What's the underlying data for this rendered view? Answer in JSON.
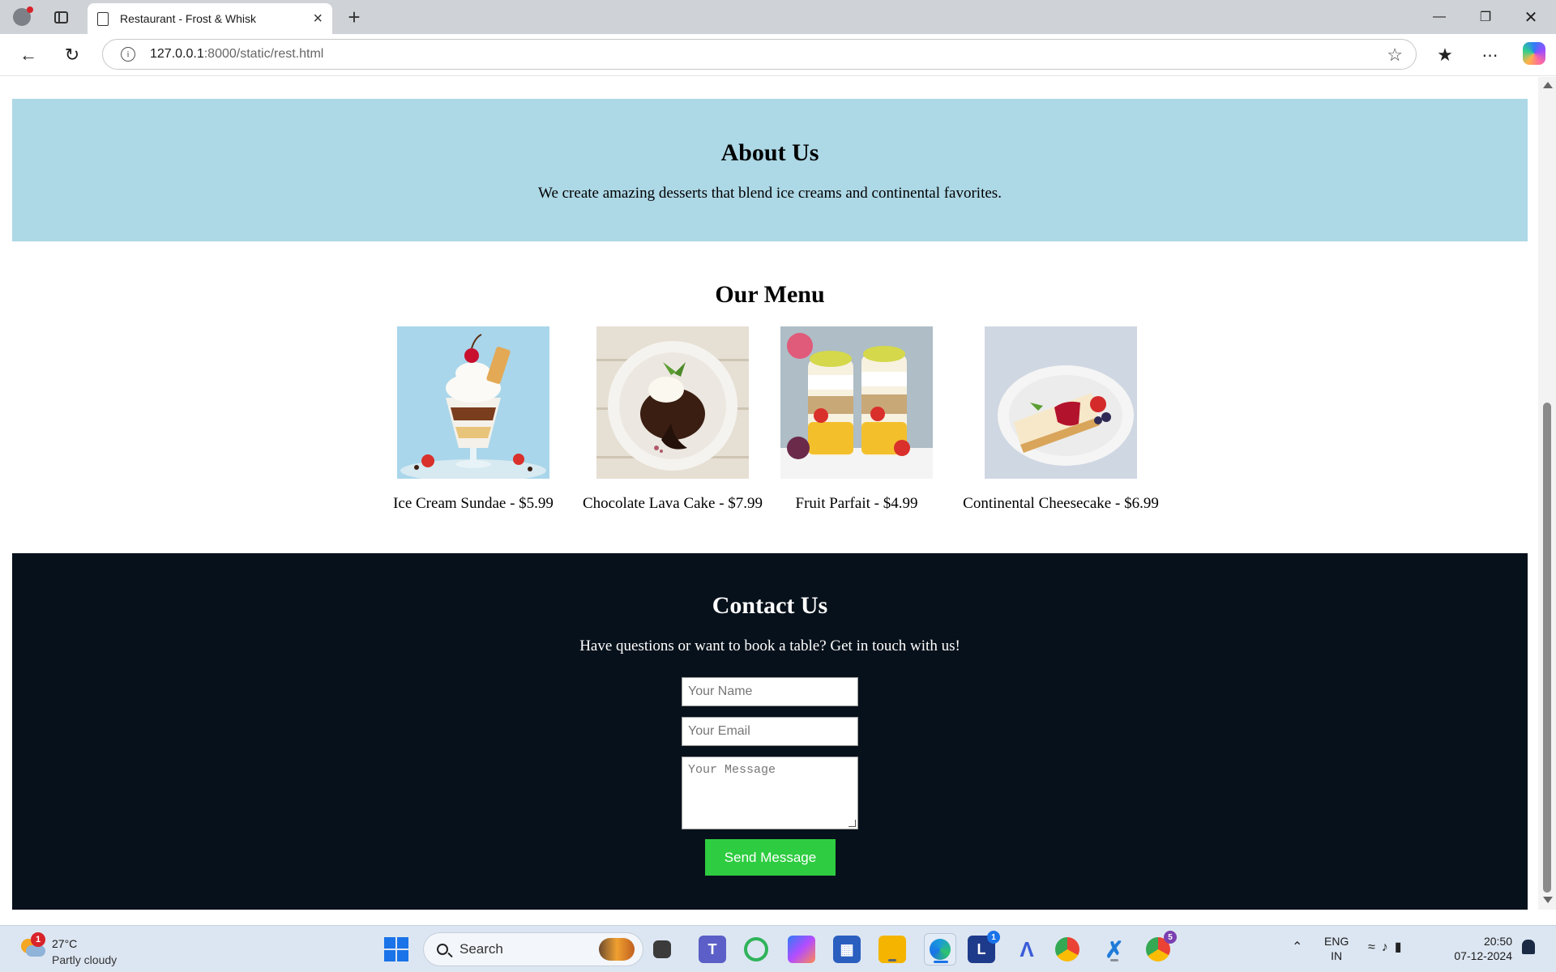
{
  "browser": {
    "tab_title": "Restaurant - Frost & Whisk",
    "url_host": "127.0.0.1",
    "url_path": ":8000/static/rest.html",
    "new_tab_glyph": "+",
    "close_glyph": "×"
  },
  "page": {
    "about": {
      "heading": "About Us",
      "text": "We create amazing desserts that blend ice creams and continental favorites.",
      "bg_color": "#add8e6"
    },
    "menu": {
      "heading": "Our Menu",
      "items": [
        {
          "caption": "Ice Cream Sundae - $5.99",
          "image": "ice-cream-sundae-photo"
        },
        {
          "caption": "Chocolate Lava Cake - $7.99",
          "image": "chocolate-lava-cake-photo"
        },
        {
          "caption": "Fruit Parfait - $4.99",
          "image": "fruit-parfait-photo"
        },
        {
          "caption": "Continental Cheesecake - $6.99",
          "image": "cheesecake-photo"
        }
      ]
    },
    "contact": {
      "heading": "Contact Us",
      "text": "Have questions or want to book a table? Get in touch with us!",
      "name_placeholder": "Your Name",
      "email_placeholder": "Your Email",
      "message_placeholder": "Your Message",
      "send_label": "Send Message",
      "bg_color": "#07111b",
      "button_color": "#2ecc40"
    }
  },
  "taskbar": {
    "weather_badge": "1",
    "temperature": "27°C",
    "condition": "Partly cloudy",
    "search_label": "Search",
    "lang_primary": "ENG",
    "lang_region": "IN",
    "time": "20:50",
    "date": "07-12-2024",
    "teams_badge": "1",
    "chrome_badge": "5"
  }
}
